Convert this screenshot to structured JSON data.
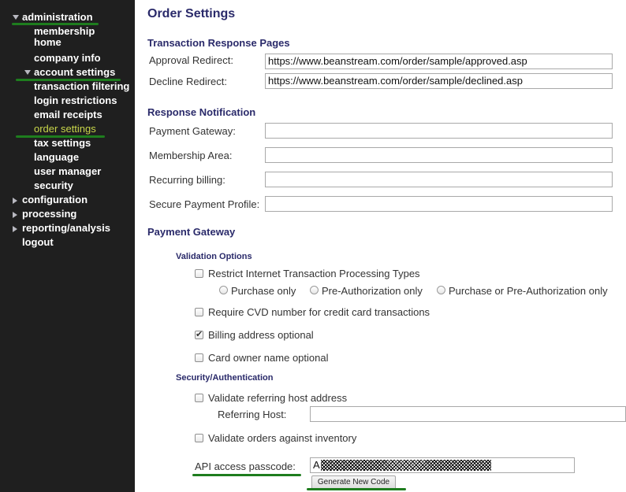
{
  "sidebar": {
    "items": [
      {
        "label": "administration"
      },
      {
        "label": "membership home"
      },
      {
        "label": "company info"
      },
      {
        "label": "account settings"
      },
      {
        "label": "transaction filtering"
      },
      {
        "label": "login restrictions"
      },
      {
        "label": "email receipts"
      },
      {
        "label": "order settings"
      },
      {
        "label": "tax settings"
      },
      {
        "label": "language"
      },
      {
        "label": "user manager"
      },
      {
        "label": "security"
      },
      {
        "label": "configuration"
      },
      {
        "label": "processing"
      },
      {
        "label": "reporting/analysis"
      },
      {
        "label": "logout"
      }
    ],
    "membership_line1": "membership",
    "membership_line2": "home"
  },
  "main": {
    "title": "Order Settings",
    "transaction_response": {
      "heading": "Transaction Response Pages",
      "approval_label": "Approval Redirect:",
      "approval_value": "https://www.beanstream.com/order/sample/approved.asp",
      "decline_label": "Decline Redirect:",
      "decline_value": "https://www.beanstream.com/order/sample/declined.asp"
    },
    "response_notification": {
      "heading": "Response Notification",
      "payment_gateway_label": "Payment Gateway:",
      "membership_area_label": "Membership Area:",
      "recurring_billing_label": "Recurring billing:",
      "secure_payment_label": "Secure Payment Profile:"
    },
    "payment_gateway": {
      "heading": "Payment Gateway",
      "validation_heading": "Validation Options",
      "restrict_label": "Restrict Internet Transaction Processing Types",
      "radio_purchase": "Purchase only",
      "radio_preauth": "Pre-Authorization only",
      "radio_both": "Purchase or Pre-Authorization only",
      "cvd_label": "Require CVD number for credit card transactions",
      "billing_label": "Billing address optional",
      "card_owner_label": "Card owner name optional",
      "security_heading": "Security/Authentication",
      "validate_host_label": "Validate referring host address",
      "referring_host_label": "Referring Host:",
      "validate_inventory_label": "Validate orders against inventory",
      "api_label": "API access passcode:",
      "api_value_visible": "A",
      "generate_button": "Generate New Code"
    }
  }
}
